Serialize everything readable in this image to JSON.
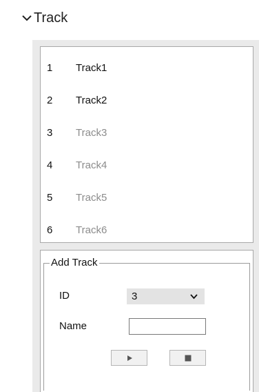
{
  "header": {
    "title": "Track",
    "toggle_icon": "chevron-down-icon"
  },
  "track_list": [
    {
      "id": "1",
      "name": "Track1",
      "enabled": true
    },
    {
      "id": "2",
      "name": "Track2",
      "enabled": true
    },
    {
      "id": "3",
      "name": "Track3",
      "enabled": false
    },
    {
      "id": "4",
      "name": "Track4",
      "enabled": false
    },
    {
      "id": "5",
      "name": "Track5",
      "enabled": false
    },
    {
      "id": "6",
      "name": "Track6",
      "enabled": false
    }
  ],
  "add_track": {
    "legend": "Add Track",
    "id_label": "ID",
    "id_value": "3",
    "name_label": "Name",
    "name_value": "",
    "play_icon": "play-icon",
    "stop_icon": "stop-icon"
  },
  "colors": {
    "panel_bg": "#eaeaea",
    "enabled_text": "#111111",
    "disabled_text": "#8c8c8c",
    "select_bg": "#e3e3e3"
  }
}
